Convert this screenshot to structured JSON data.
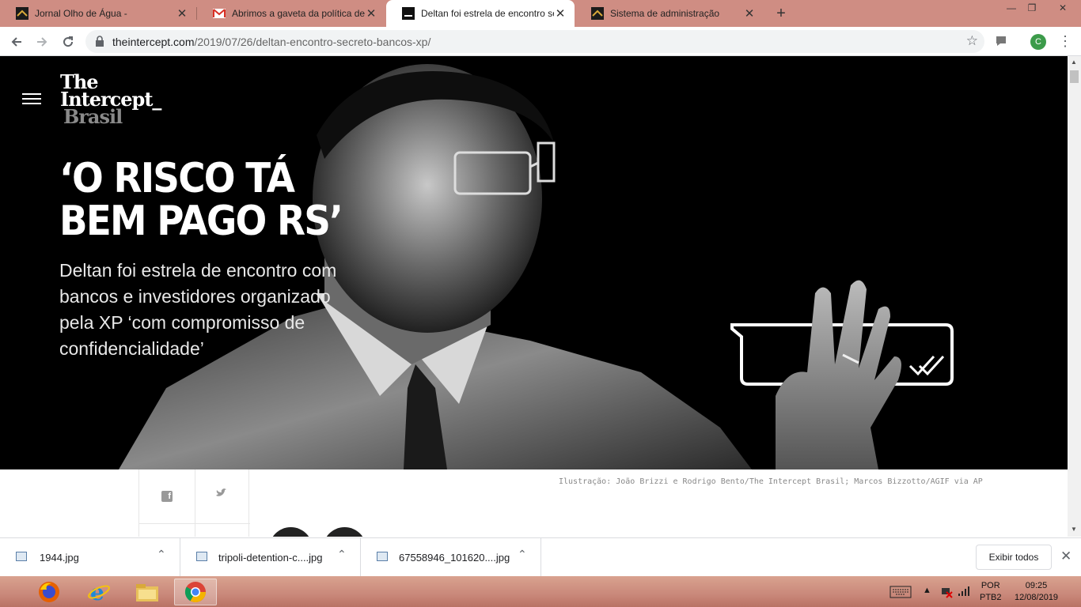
{
  "browser": {
    "tabs": [
      {
        "title": "Jornal Olho de Água -",
        "active": false,
        "favicon": "olho-favicon"
      },
      {
        "title": "Abrimos a gaveta da política de combate",
        "active": false,
        "favicon": "gmail-favicon"
      },
      {
        "title": "Deltan foi estrela de encontro secreto",
        "active": true,
        "favicon": "intercept-favicon"
      },
      {
        "title": "Sistema de administração",
        "active": false,
        "favicon": "olho-favicon"
      }
    ],
    "new_tab": "+",
    "window_controls": {
      "minimize": "—",
      "restore": "❐",
      "close": "✕"
    },
    "url_host": "theintercept.com",
    "url_path": "/2019/07/26/deltan-encontro-secreto-bancos-xp/",
    "avatar_letter": "C",
    "colors": {
      "tabstrip": "#cf8d83",
      "omnibox": "#f1f3f4"
    }
  },
  "page": {
    "logo": {
      "line1": "The",
      "line2": "Intercept_",
      "line3": "Brasil"
    },
    "headline": "‘O RISCO TÁ\nBEM PAGO RS’",
    "dek": "Deltan foi estrela de encontro com bancos e investidores organizado pela XP ‘com compromisso de confidencialidade’",
    "photo_credit": "Ilustração: João Brizzi e Rodrigo Bento/The Intercept Brasil; Marcos Bizzotto/AGIF via AP",
    "share": {
      "facebook": "f",
      "twitter": "🐦"
    }
  },
  "downloads": {
    "items": [
      {
        "name": "1944.jpg"
      },
      {
        "name": "tripoli-detention-c....jpg"
      },
      {
        "name": "67558946_101620....jpg"
      }
    ],
    "show_all": "Exibir todos",
    "close": "✕"
  },
  "taskbar": {
    "apps": [
      "firefox-icon",
      "internet-explorer-icon",
      "file-explorer-icon",
      "chrome-icon"
    ],
    "lang_top": "POR",
    "lang_bottom": "PTB2",
    "time": "09:25",
    "date": "12/08/2019"
  }
}
